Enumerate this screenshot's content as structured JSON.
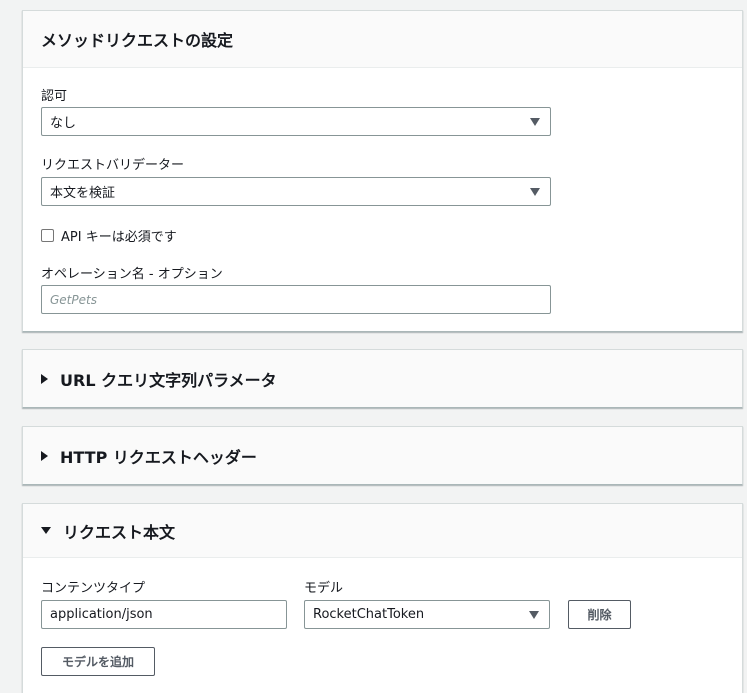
{
  "method_request": {
    "title": "メソッドリクエストの設定",
    "auth_label": "認可",
    "auth_value": "なし",
    "validator_label": "リクエストバリデーター",
    "validator_value": "本文を検証",
    "api_key_label": "API キーは必須です",
    "operation_label": "オペレーション名 - オプション",
    "operation_placeholder": "GetPets"
  },
  "url_query": {
    "title": "URL クエリ文字列パラメータ"
  },
  "http_headers": {
    "title": "HTTP リクエストヘッダー"
  },
  "request_body": {
    "title": "リクエスト本文",
    "content_type_label": "コンテンツタイプ",
    "model_label": "モデル",
    "content_type_value": "application/json",
    "model_value": "RocketChatToken",
    "delete_label": "削除",
    "add_model_label": "モデルを追加"
  }
}
